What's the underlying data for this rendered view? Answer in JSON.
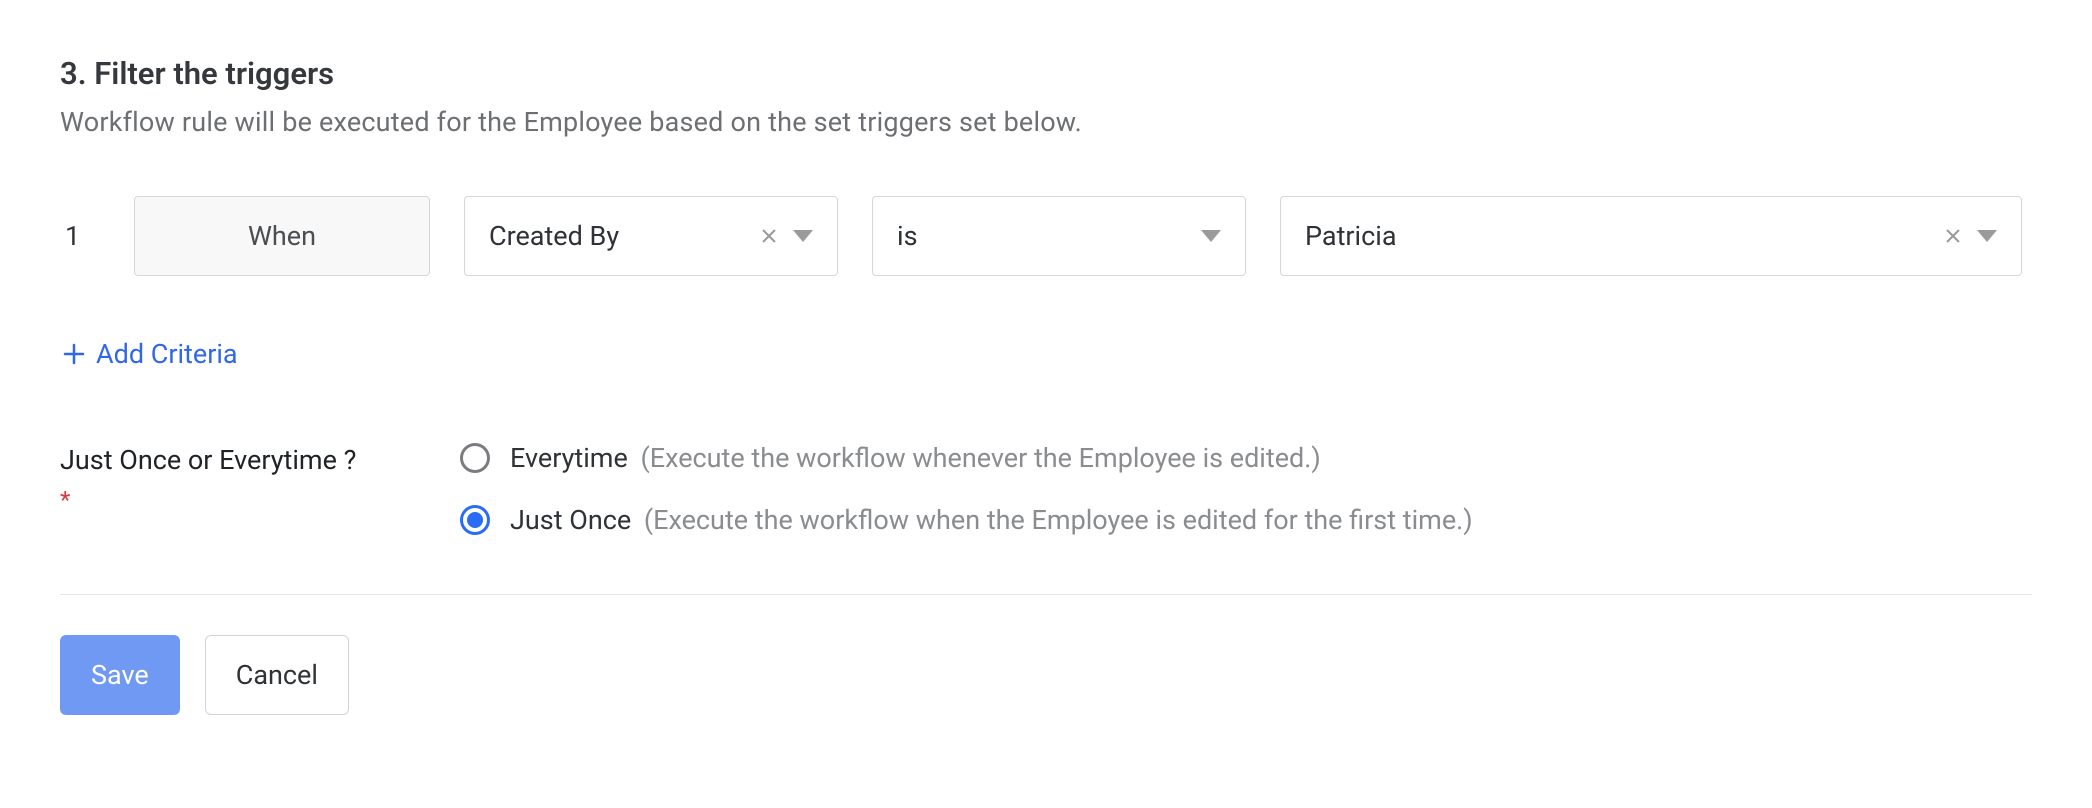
{
  "section": {
    "title": "3. Filter the triggers",
    "description": "Workflow rule will be executed for the Employee based on the set triggers set below."
  },
  "criteria": {
    "row_index": "1",
    "when_label": "When",
    "field": "Created By",
    "operator": "is",
    "value": "Patricia"
  },
  "add_criteria_label": "Add Criteria",
  "frequency": {
    "question": "Just Once or Everytime ?",
    "options": {
      "everytime": {
        "label": "Everytime",
        "hint": "(Execute the workflow whenever the Employee is edited.)"
      },
      "just_once": {
        "label": "Just Once",
        "hint": "(Execute the workflow when the Employee is edited for the first time.)"
      }
    },
    "selected": "just_once"
  },
  "actions": {
    "save": "Save",
    "cancel": "Cancel"
  }
}
